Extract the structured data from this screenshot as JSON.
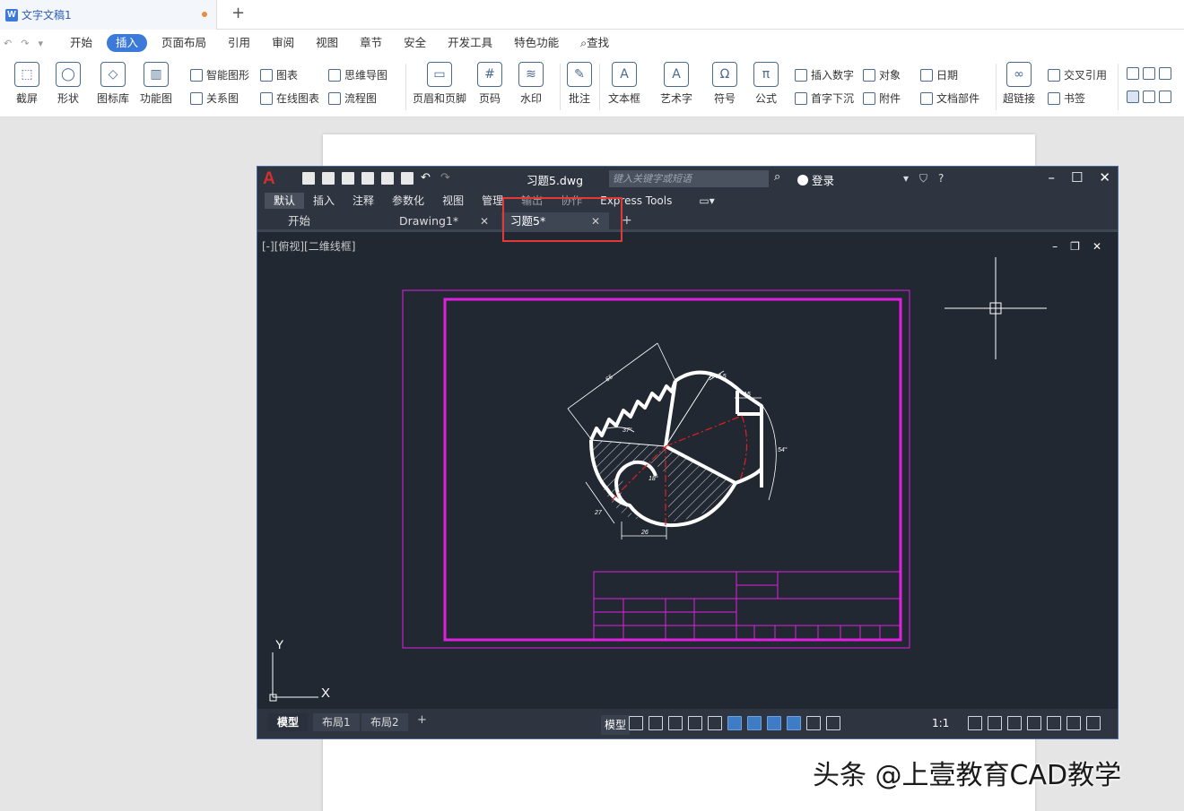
{
  "wps": {
    "doc_tab_title": "文字文稿1",
    "menu": [
      "开始",
      "插入",
      "页面布局",
      "引用",
      "审阅",
      "视图",
      "章节",
      "安全",
      "开发工具",
      "特色功能",
      "查找"
    ],
    "active_menu": "插入",
    "ribbon": {
      "screenshot": "截屏",
      "shape": "形状",
      "icon_lib": "图标库",
      "func_chart": "功能图",
      "smart_graphic": "智能图形",
      "chart": "图表",
      "mind_map": "思维导图",
      "relation": "关系图",
      "online_chart": "在线图表",
      "flowchart": "流程图",
      "header_footer": "页眉和页脚",
      "page_num": "页码",
      "watermark": "水印",
      "comment": "批注",
      "textbox": "文本框",
      "wordart": "艺术字",
      "symbol": "符号",
      "formula": "公式",
      "insert_number": "插入数字",
      "object": "对象",
      "date": "日期",
      "drop_cap": "首字下沉",
      "attachment": "附件",
      "doc_parts": "文档部件",
      "hyperlink": "超链接",
      "cross_ref": "交叉引用",
      "bookmark": "书签"
    }
  },
  "cad": {
    "filename": "习题5.dwg",
    "search_placeholder": "键入关键字或短语",
    "login": "登录",
    "ribbon_tabs": [
      "默认",
      "插入",
      "注释",
      "参数化",
      "视图",
      "管理",
      "输出",
      "协作",
      "Express Tools"
    ],
    "doc_tabs": [
      "开始",
      "Drawing1*",
      "习题5*"
    ],
    "viewport_label": "[-][俯视][二维线框]",
    "dims": {
      "d65": "65",
      "r445": "R44.5",
      "d15": "15",
      "a37": "37°",
      "a54": "54°",
      "a18": "18°",
      "d27": "27",
      "d26": "26"
    },
    "ucs": {
      "y": "Y",
      "x": "X"
    },
    "layout_tabs": [
      "模型",
      "布局1",
      "布局2"
    ],
    "status_model": "模型",
    "status_scale": "1:1"
  },
  "watermark": "头条 @上壹教育CAD教学"
}
